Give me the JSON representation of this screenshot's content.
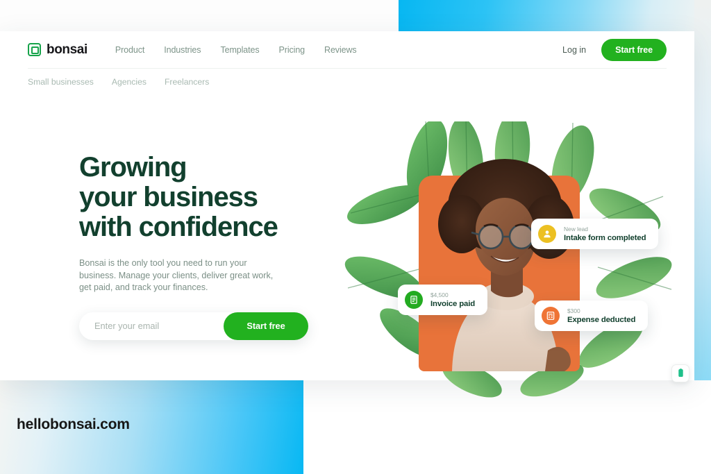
{
  "background": {
    "site_url": "hellobonsai.com",
    "accent_cyan": "#07b8f3",
    "card_bg": "#ffffff"
  },
  "nav": {
    "brand": "bonsai",
    "logo_icon": "bonsai-square-logo-icon",
    "links": [
      {
        "label": "Product"
      },
      {
        "label": "Industries"
      },
      {
        "label": "Templates"
      },
      {
        "label": "Pricing"
      },
      {
        "label": "Reviews"
      }
    ],
    "login_label": "Log in",
    "cta_label": "Start free",
    "cta_color": "#22b11f"
  },
  "subnav": {
    "items": [
      {
        "label": "Small businesses"
      },
      {
        "label": "Agencies"
      },
      {
        "label": "Freelancers"
      }
    ]
  },
  "hero": {
    "headline_line1": "Growing",
    "headline_line2": "your business",
    "headline_line3": "with confidence",
    "headline_color": "#12402e",
    "subcopy": "Bonsai is the only tool you need to run your business. Manage your clients, deliver great work, get paid, and track your finances.",
    "email_placeholder": "Enter your email",
    "email_value": "",
    "cta_label": "Start free"
  },
  "notifications": [
    {
      "id": "new-lead",
      "sub": "New lead",
      "title": "Intake form completed",
      "icon": "person-icon",
      "icon_color": "#ecc022"
    },
    {
      "id": "invoice-paid",
      "sub": "$4,500",
      "title": "Invoice paid",
      "icon": "invoice-icon",
      "icon_color": "#23ab21"
    },
    {
      "id": "expense-deducted",
      "sub": "$300",
      "title": "Expense deducted",
      "icon": "calculator-icon",
      "icon_color": "#ef7435"
    }
  ],
  "chat_widget": {
    "icon": "chat-bubble-icon",
    "icon_color": "#1fc08a"
  }
}
